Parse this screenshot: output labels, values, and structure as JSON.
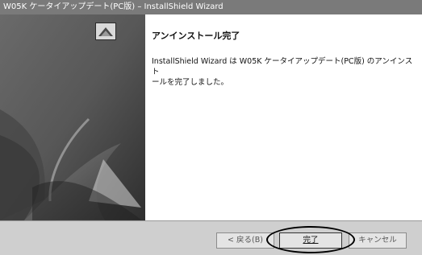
{
  "window": {
    "title": "W05K ケータイアップデート(PC版) – InstallShield Wizard"
  },
  "content": {
    "heading": "アンインストール完了",
    "message": "InstallShield Wizard は W05K ケータイアップデート(PC版) のアンインスト\nールを完了しました。"
  },
  "buttons": {
    "back_label": "< 戻る(B)",
    "finish_label": "完了",
    "cancel_label": "キャンセル"
  },
  "icons": {
    "installer": "installshield-logo-icon"
  }
}
